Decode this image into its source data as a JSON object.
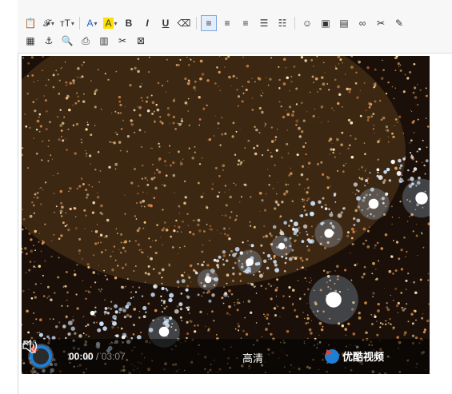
{
  "toolbar": {
    "row1": [
      {
        "name": "paste-icon",
        "glyph": "📋"
      },
      {
        "name": "font-family-icon",
        "glyph": "𝓕",
        "dropdown": true
      },
      {
        "name": "font-size-icon",
        "glyph": "тT",
        "dropdown": true
      },
      {
        "sep": true
      },
      {
        "name": "font-color-icon",
        "glyph": "A",
        "dropdown": true,
        "color": "#1e5fbf"
      },
      {
        "name": "highlight-color-icon",
        "glyph": "A",
        "dropdown": true,
        "bg": "#ffe100"
      },
      {
        "name": "bold-icon",
        "glyph": "B"
      },
      {
        "name": "italic-icon",
        "glyph": "I"
      },
      {
        "name": "underline-icon",
        "glyph": "U"
      },
      {
        "name": "eraser-icon",
        "glyph": "⌫"
      },
      {
        "sep": true
      },
      {
        "name": "align-left-icon",
        "glyph": "≡",
        "active": true
      },
      {
        "name": "align-center-icon",
        "glyph": "≡"
      },
      {
        "name": "align-right-icon",
        "glyph": "≡"
      },
      {
        "name": "ordered-list-icon",
        "glyph": "☰"
      },
      {
        "name": "unordered-list-icon",
        "glyph": "☷"
      },
      {
        "sep": true
      },
      {
        "name": "emoticon-icon",
        "glyph": "☺"
      },
      {
        "name": "insert-image-icon",
        "glyph": "▣"
      },
      {
        "name": "insert-gallery-icon",
        "glyph": "▤"
      },
      {
        "name": "link-icon",
        "glyph": "∞"
      },
      {
        "name": "unlink-icon",
        "glyph": "✂"
      },
      {
        "name": "format-brush-icon",
        "glyph": "✎"
      }
    ],
    "row2": [
      {
        "name": "table-icon",
        "glyph": "▦"
      },
      {
        "name": "anchor-icon",
        "glyph": "⚓"
      },
      {
        "name": "preview-icon",
        "glyph": "🔍"
      },
      {
        "name": "print-icon",
        "glyph": "⎙"
      },
      {
        "name": "template-icon",
        "glyph": "▥"
      },
      {
        "name": "cut-icon",
        "glyph": "✂"
      },
      {
        "name": "page-break-icon",
        "glyph": "⊠"
      }
    ]
  },
  "video": {
    "time_current": "00:00",
    "time_separator": "/",
    "time_total": "03:07",
    "quality_label": "高清",
    "brand_label": "优酷视频",
    "icons": {
      "play": "play-icon",
      "volume": "volume-icon",
      "brand_logo": "youku-logo-icon",
      "fullscreen": "fullscreen-icon"
    },
    "accent_color": "#1e7fd4"
  }
}
